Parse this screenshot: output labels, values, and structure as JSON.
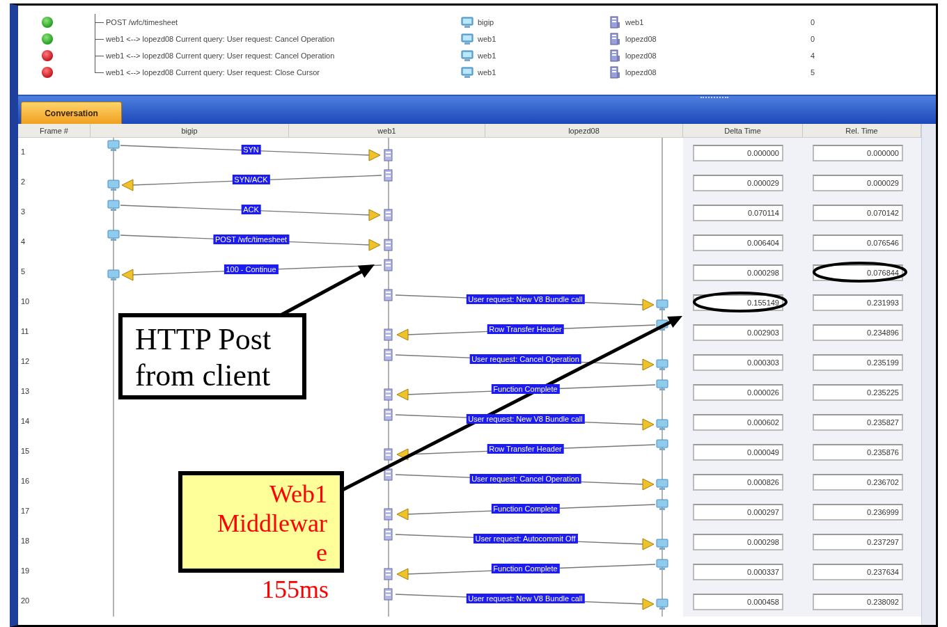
{
  "top_list": {
    "rows": [
      {
        "error": false,
        "text": "POST /wfc/timesheet",
        "source": "bigip",
        "destination": "web1",
        "count": "0"
      },
      {
        "error": false,
        "text": "web1 <--> lopezd08 Current query: User request: Cancel Operation",
        "source": "web1",
        "destination": "lopezd08",
        "count": "0"
      },
      {
        "error": true,
        "text": "web1 <--> lopezd08 Current query: User request: Cancel Operation",
        "source": "web1",
        "destination": "lopezd08",
        "count": "4"
      },
      {
        "error": true,
        "text": "web1 <--> lopezd08 Current query: User request: Close Cursor",
        "source": "web1",
        "destination": "lopezd08",
        "count": "5"
      }
    ]
  },
  "tabs": [
    {
      "label": "Conversation",
      "selected": true
    }
  ],
  "conversation": {
    "columns": [
      "Frame #",
      "bigip",
      "web1",
      "lopezd08",
      "Delta Time",
      "Rel. Time"
    ],
    "rows": [
      {
        "frame": "1",
        "message": "SYN",
        "reply": false,
        "backend": false,
        "delta": "0.000000",
        "rel": "0.000000"
      },
      {
        "frame": "2",
        "message": "SYN/ACK",
        "reply": true,
        "backend": false,
        "delta": "0.000029",
        "rel": "0.000029"
      },
      {
        "frame": "3",
        "message": "ACK",
        "reply": false,
        "backend": false,
        "delta": "0.070114",
        "rel": "0.070142"
      },
      {
        "frame": "4",
        "message": "POST /wfc/timesheet",
        "reply": false,
        "backend": false,
        "delta": "0.006404",
        "rel": "0.076546"
      },
      {
        "frame": "5",
        "message": "100 - Continue",
        "reply": true,
        "backend": false,
        "delta": "0.000298",
        "rel": "0.076844",
        "rel_circled": true
      },
      {
        "frame": "10",
        "message": "User request: New V8 Bundle call",
        "reply": false,
        "backend": true,
        "delta": "0.155149",
        "rel": "0.231993",
        "delta_circled": true
      },
      {
        "frame": "11",
        "message": "Row Transfer Header",
        "reply": true,
        "backend": true,
        "delta": "0.002903",
        "rel": "0.234896"
      },
      {
        "frame": "12",
        "message": "User request: Cancel Operation",
        "reply": false,
        "backend": true,
        "delta": "0.000303",
        "rel": "0.235199"
      },
      {
        "frame": "13",
        "message": "Function Complete",
        "reply": true,
        "backend": true,
        "delta": "0.000026",
        "rel": "0.235225"
      },
      {
        "frame": "14",
        "message": "User request: New V8 Bundle call",
        "reply": false,
        "backend": true,
        "delta": "0.000602",
        "rel": "0.235827"
      },
      {
        "frame": "15",
        "message": "Row Transfer Header",
        "reply": true,
        "backend": true,
        "delta": "0.000049",
        "rel": "0.235876"
      },
      {
        "frame": "16",
        "message": "User request: Cancel Operation",
        "reply": false,
        "backend": true,
        "delta": "0.000826",
        "rel": "0.236702"
      },
      {
        "frame": "17",
        "message": "Function Complete",
        "reply": true,
        "backend": true,
        "delta": "0.000297",
        "rel": "0.236999"
      },
      {
        "frame": "18",
        "message": "User request: Autocommit Off",
        "reply": false,
        "backend": true,
        "delta": "0.000298",
        "rel": "0.237297"
      },
      {
        "frame": "19",
        "message": "Function Complete",
        "reply": true,
        "backend": true,
        "delta": "0.000337",
        "rel": "0.237634"
      },
      {
        "frame": "20",
        "message": "User request: New V8 Bundle call",
        "reply": false,
        "backend": true,
        "delta": "0.000458",
        "rel": "0.238092"
      }
    ]
  },
  "annotations": [
    {
      "kind": "plain",
      "text": "HTTP Post from client"
    },
    {
      "kind": "highlight",
      "text": "Web1 Middleware",
      "note": "155ms"
    }
  ]
}
